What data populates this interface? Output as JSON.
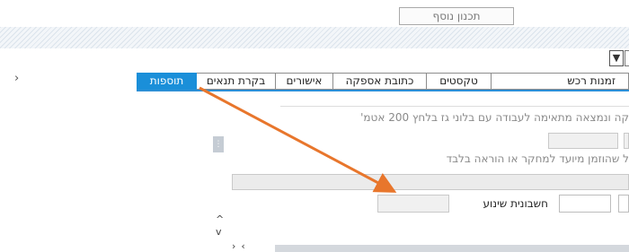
{
  "top": {
    "add_plan_button": "תכנון נוסף"
  },
  "tabs": [
    {
      "label": "תוספות",
      "active": true
    },
    {
      "label": "בקרת תנאים",
      "active": false
    },
    {
      "label": "אישורים",
      "active": false
    },
    {
      "label": "כתובת אספקה",
      "active": false
    },
    {
      "label": "טקסטים",
      "active": false
    },
    {
      "label": "זמנות רכש",
      "active": false
    }
  ],
  "content": {
    "line1": "קה ונמצאה מתאימה לעבודה עם בלוני גז בלחץ 200 אטמ'",
    "line2": "ל שהוזמן מיועד למחקר או הוראה בלבד",
    "field_label": "חשבונית שינוע"
  },
  "icons": {
    "dropdown": "triangle-down-icon",
    "left_chevron": "chevron-right-icon",
    "scroll_up": "chevron-up-icon",
    "scroll_down": "chevron-down-icon"
  },
  "colors": {
    "active_tab": "#1a8fd9",
    "annotation_arrow": "#e8762c"
  }
}
